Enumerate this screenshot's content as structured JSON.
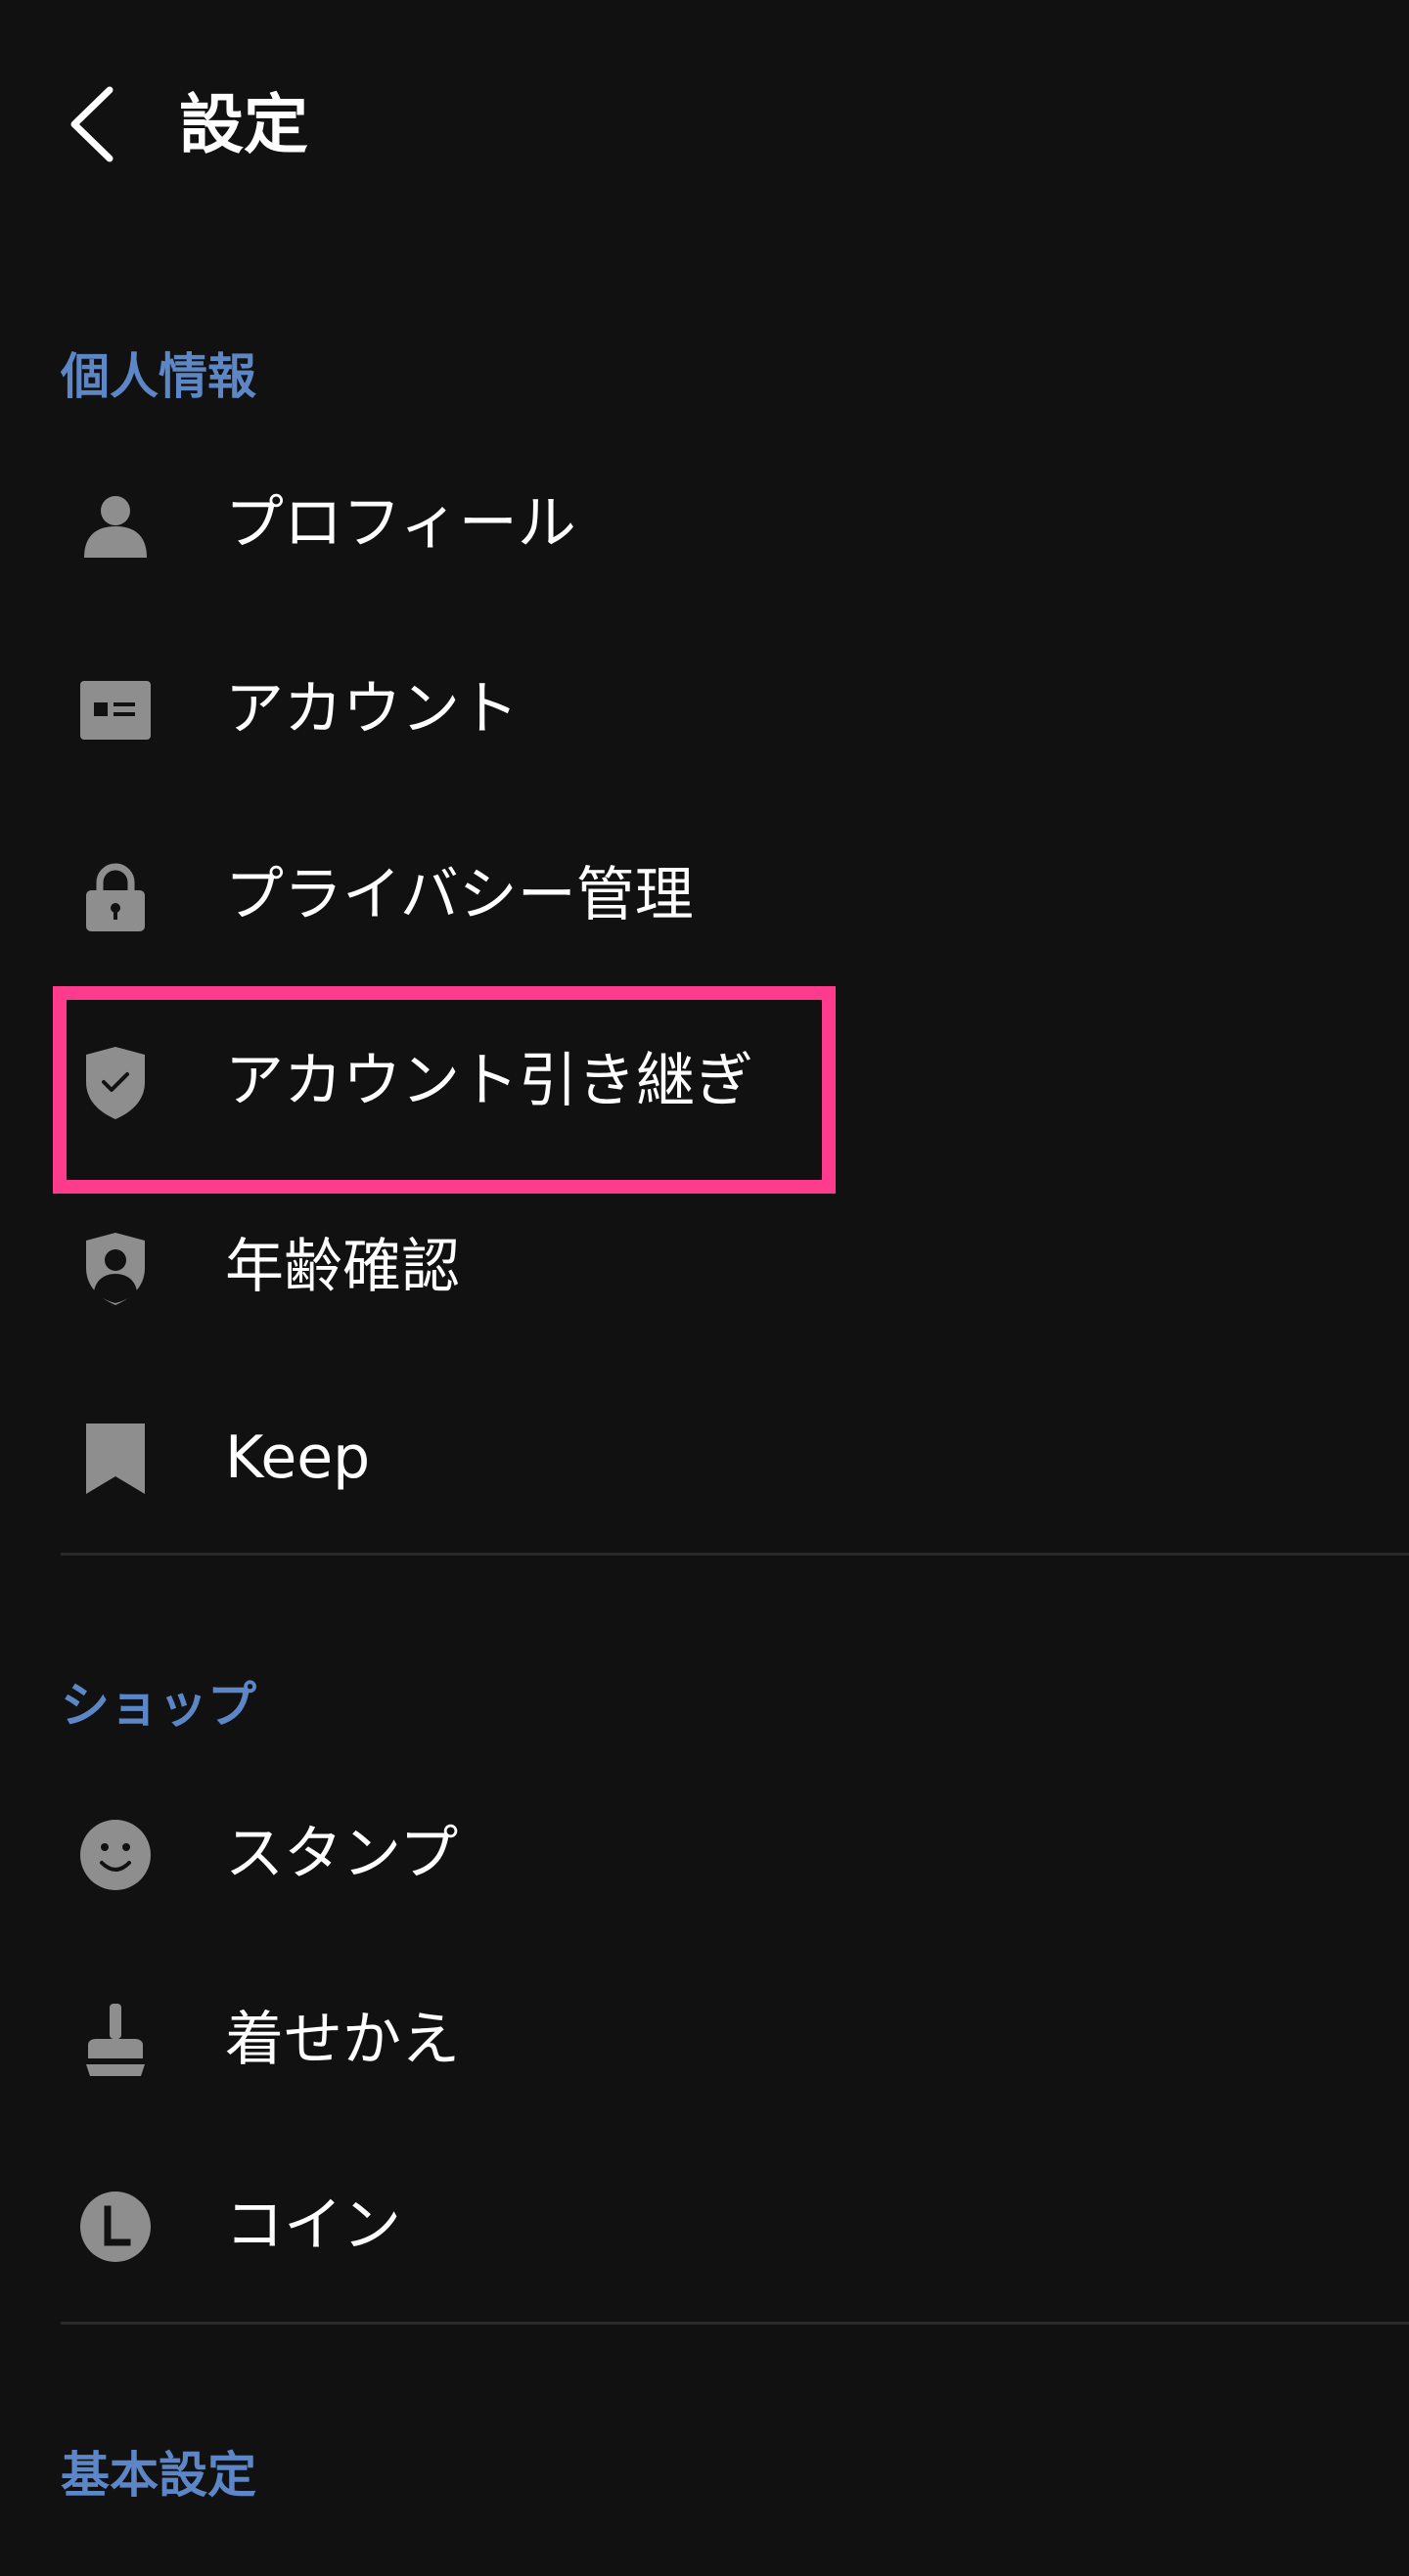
{
  "header": {
    "title": "設定",
    "back_icon": "chevron-left-icon"
  },
  "sections": [
    {
      "title": "個人情報",
      "items": [
        {
          "label": "プロフィール",
          "icon": "person-icon"
        },
        {
          "label": "アカウント",
          "icon": "id-card-icon"
        },
        {
          "label": "プライバシー管理",
          "icon": "lock-icon"
        },
        {
          "label": "アカウント引き継ぎ",
          "icon": "shield-check-icon",
          "highlighted": true
        },
        {
          "label": "年齢確認",
          "icon": "shield-person-icon"
        },
        {
          "label": "Keep",
          "icon": "bookmark-icon"
        }
      ]
    },
    {
      "title": "ショップ",
      "items": [
        {
          "label": "スタンプ",
          "icon": "smiley-icon"
        },
        {
          "label": "着せかえ",
          "icon": "brush-icon"
        },
        {
          "label": "コイン",
          "icon": "coin-icon"
        }
      ]
    },
    {
      "title": "基本設定",
      "items": []
    }
  ],
  "colors": {
    "background": "#111111",
    "section_title": "#5d86c7",
    "icon": "#8e8e8e",
    "highlight_border": "#ff3b8d",
    "divider": "#2a2a2a"
  }
}
